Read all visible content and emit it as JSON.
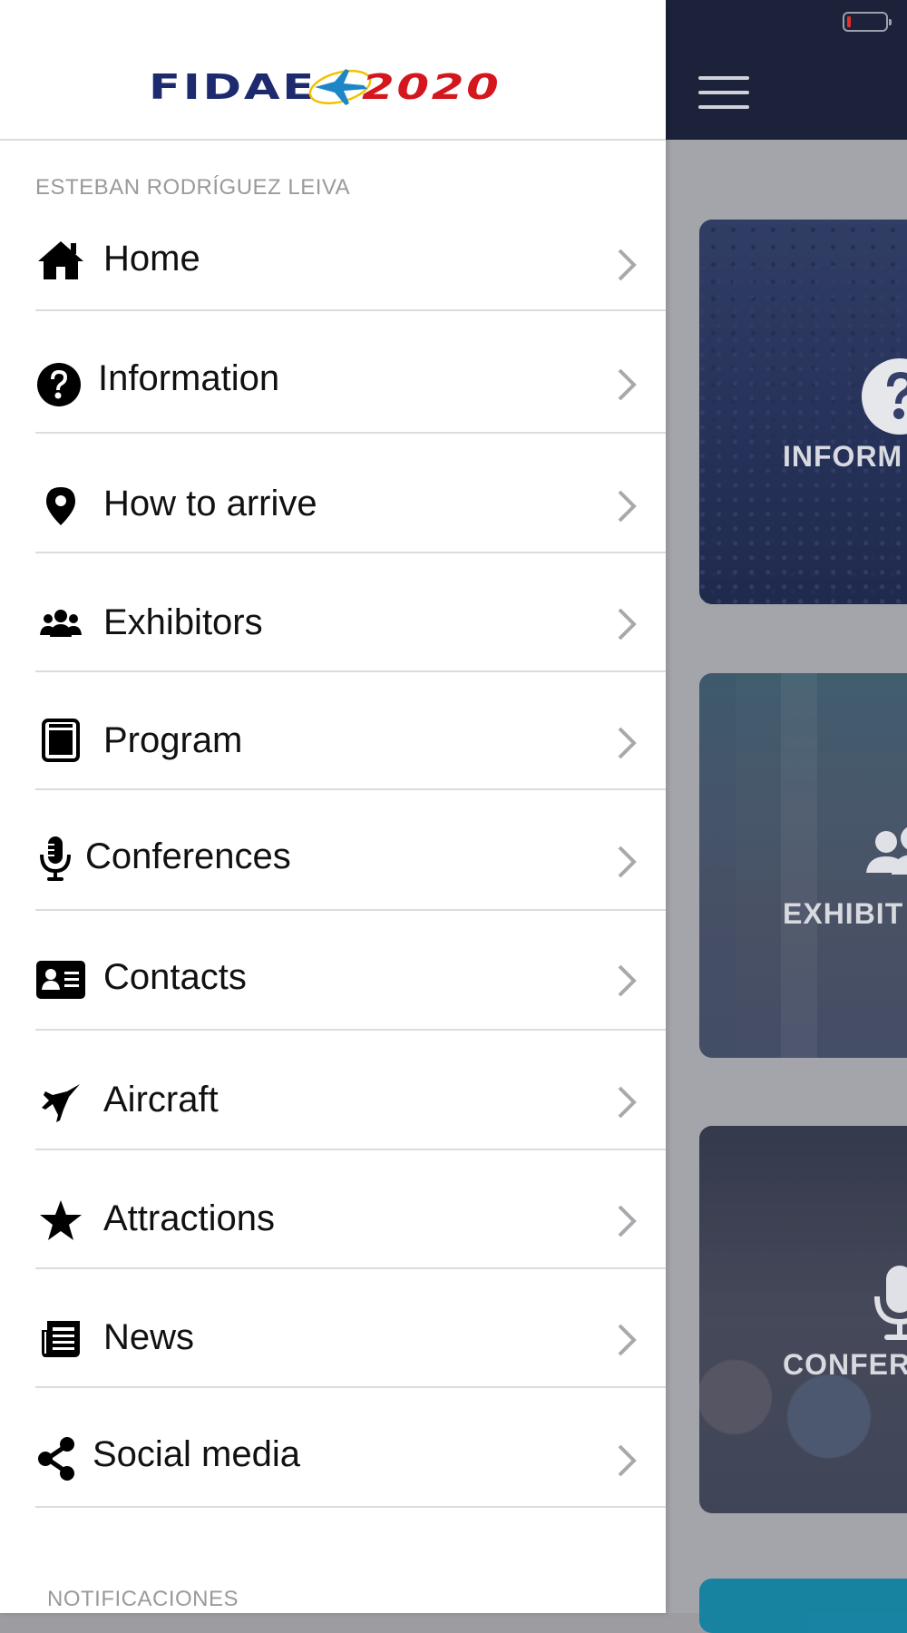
{
  "app": {
    "logo_left": "FIDAE",
    "logo_right": "2020",
    "brand_colors": {
      "navy": "#1d2a6e",
      "red": "#d4161e",
      "header_bg": "#1b2239"
    }
  },
  "status_bar": {
    "battery_icon": "battery-low-icon",
    "battery_color": "#e0302a"
  },
  "background": {
    "menu_icon": "hamburger-menu-icon",
    "cards": [
      {
        "label": "INFORM",
        "icon": "question-circle-icon"
      },
      {
        "label": "EXHIBIT",
        "icon": "users-icon"
      },
      {
        "label": "CONFER",
        "icon": "microphone-icon"
      }
    ]
  },
  "drawer": {
    "user_name": "ESTEBAN RODRÍGUEZ LEIVA",
    "menu": [
      {
        "label": "Home",
        "icon": "home-icon"
      },
      {
        "label": "Information",
        "icon": "question-circle-icon"
      },
      {
        "label": "How to arrive",
        "icon": "map-pin-icon"
      },
      {
        "label": "Exhibitors",
        "icon": "users-icon"
      },
      {
        "label": "Program",
        "icon": "calendar-icon"
      },
      {
        "label": "Conferences",
        "icon": "microphone-icon"
      },
      {
        "label": "Contacts",
        "icon": "id-card-icon"
      },
      {
        "label": "Aircraft",
        "icon": "fighter-jet-icon"
      },
      {
        "label": "Attractions",
        "icon": "star-icon"
      },
      {
        "label": "News",
        "icon": "newspaper-icon"
      },
      {
        "label": "Social media",
        "icon": "share-icon"
      }
    ],
    "notifications_title": "NOTIFICACIONES",
    "chevron_icon": "chevron-right-icon"
  }
}
